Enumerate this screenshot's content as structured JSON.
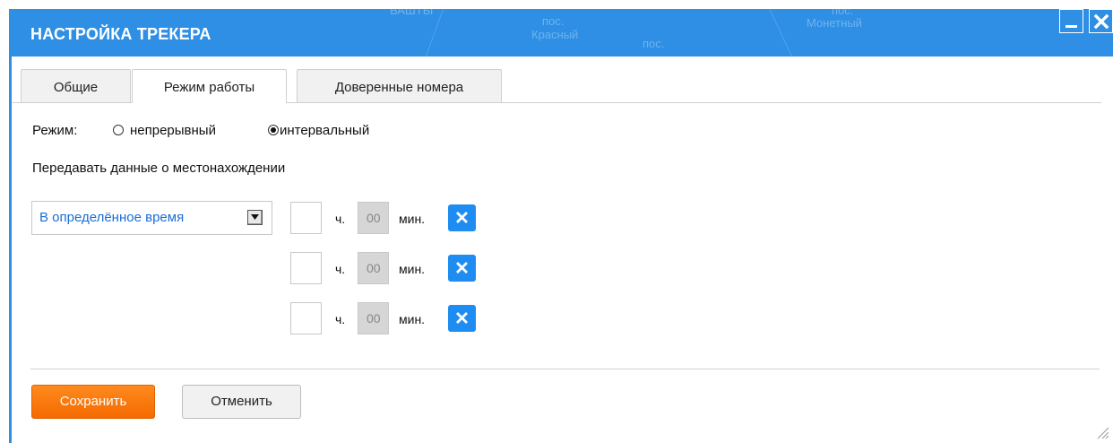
{
  "window": {
    "title": "НАСТРОЙКА ТРЕКЕРА",
    "minimize_icon": "minimize-icon",
    "close_icon": "close-icon",
    "accent_color": "#2e8fe4"
  },
  "map_background": {
    "labels": [
      "ВАШТЫ",
      "пос.",
      "Красный",
      "пос.",
      "пос.",
      "Монетный"
    ]
  },
  "tabs": [
    {
      "label": "Общие",
      "active": false
    },
    {
      "label": "Режим работы",
      "active": true
    },
    {
      "label": "Доверенные номера",
      "active": false
    }
  ],
  "mode": {
    "label": "Режим:",
    "options": [
      {
        "label": "непрерывный",
        "selected": false
      },
      {
        "label": "интервальный",
        "selected": true
      }
    ]
  },
  "transmit": {
    "heading": "Передавать данные о местонахождении",
    "schedule_select": "В определённое время",
    "time_rows": [
      {
        "hours": "",
        "hours_label": "ч.",
        "minutes": "00",
        "minutes_label": "мин."
      },
      {
        "hours": "",
        "hours_label": "ч.",
        "minutes": "00",
        "minutes_label": "мин."
      },
      {
        "hours": "",
        "hours_label": "ч.",
        "minutes": "00",
        "minutes_label": "мин."
      }
    ]
  },
  "actions": {
    "save_label": "Сохранить",
    "cancel_label": "Отменить",
    "save_color": "#f47a0c"
  }
}
